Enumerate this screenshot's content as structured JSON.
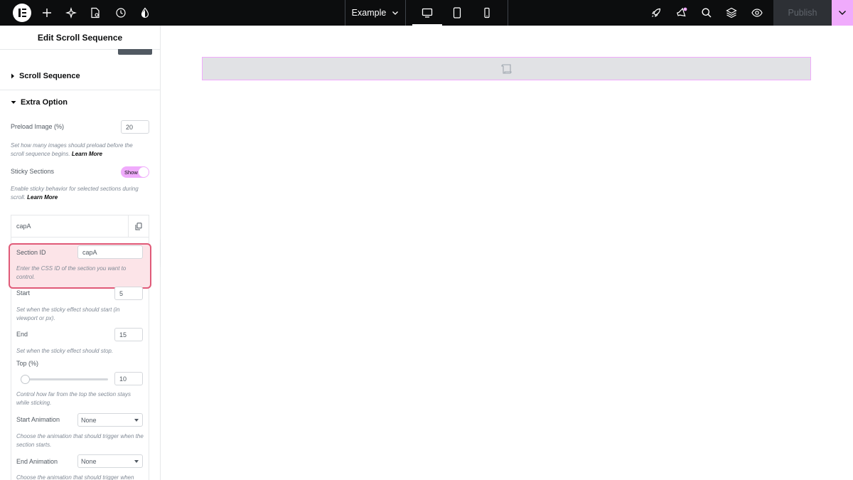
{
  "topbar": {
    "document_title": "Example",
    "publish_label": "Publish",
    "icons": [
      "elementor-logo-icon",
      "add-icon",
      "ai-sparkle-icon",
      "page-settings-icon",
      "history-icon",
      "theme-style-icon",
      "rocket-icon",
      "announcement-icon",
      "search-icon",
      "layers-icon",
      "preview-icon",
      "chevron-down-icon"
    ],
    "devices": [
      "desktop-icon",
      "tablet-icon",
      "mobile-icon"
    ]
  },
  "panel": {
    "title": "Edit Scroll Sequence",
    "sections": {
      "scroll_sequence": "Scroll Sequence",
      "extra_option": "Extra Option"
    },
    "preload": {
      "label": "Preload Image (%)",
      "value": "20",
      "desc": "Set how many images should preload before the scroll sequence begins.",
      "link": "Learn More"
    },
    "sticky": {
      "label": "Sticky Sections",
      "toggle_label": "Show",
      "desc": "Enable sticky behavior for selected sections during scroll.",
      "link": "Learn More"
    },
    "repeater": {
      "item_title": "capA",
      "section_id_label": "Section ID",
      "section_id_value": "capA",
      "section_id_desc": "Enter the CSS ID of the section you want to control.",
      "start_label": "Start",
      "start_value": "5",
      "start_desc": "Set when the sticky effect should start (in viewport or px).",
      "end_label": "End",
      "end_value": "15",
      "end_desc": "Set when the sticky effect should stop.",
      "top_label": "Top (%)",
      "top_value": "10",
      "top_desc": "Control how far from the top the section stays while sticking.",
      "start_anim_label": "Start Animation",
      "start_anim_value": "None",
      "start_anim_desc": "Choose the animation that should trigger when the section starts.",
      "end_anim_label": "End Animation",
      "end_anim_value": "None",
      "end_anim_desc": "Choose the animation that should trigger when"
    }
  },
  "colors": {
    "topbar": "#0c0d0e",
    "accent": "#f0abfc",
    "highlight_border": "#e05a78",
    "highlight_fill": "#fce4e8"
  }
}
